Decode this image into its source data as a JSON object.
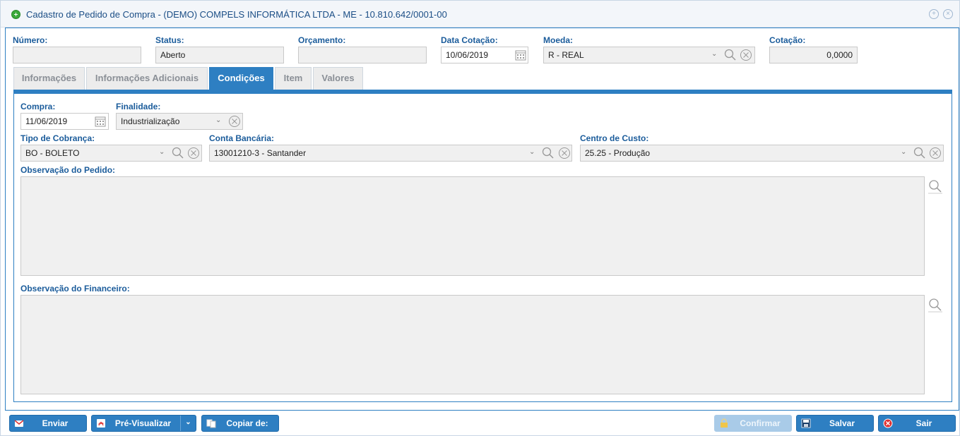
{
  "window": {
    "title": "Cadastro de Pedido de Compra - (DEMO) COMPELS INFORMÁTICA LTDA - ME - 10.810.642/0001-00"
  },
  "header": {
    "numero": {
      "label": "Número:",
      "value": ""
    },
    "status": {
      "label": "Status:",
      "value": "Aberto"
    },
    "orcamento": {
      "label": "Orçamento:",
      "value": ""
    },
    "data_cotacao": {
      "label": "Data Cotação:",
      "value": "10/06/2019"
    },
    "moeda": {
      "label": "Moeda:",
      "value": "R - REAL"
    },
    "cotacao": {
      "label": "Cotação:",
      "value": "0,0000"
    }
  },
  "tabs": [
    {
      "label": "Informações",
      "active": false
    },
    {
      "label": "Informações Adicionais",
      "active": false
    },
    {
      "label": "Condições",
      "active": true
    },
    {
      "label": "Item",
      "active": false
    },
    {
      "label": "Valores",
      "active": false
    }
  ],
  "conditions": {
    "compra": {
      "label": "Compra:",
      "value": "11/06/2019"
    },
    "finalidade": {
      "label": "Finalidade:",
      "value": "Industrialização"
    },
    "tipo_cobranca": {
      "label": "Tipo de Cobrança:",
      "value": "BO - BOLETO"
    },
    "conta_bancaria": {
      "label": "Conta Bancária:",
      "value": "13001210-3 - Santander"
    },
    "centro_custo": {
      "label": "Centro de Custo:",
      "value": "25.25 - Produção"
    },
    "obs_pedido": {
      "label": "Observação do Pedido:",
      "value": ""
    },
    "obs_financeiro": {
      "label": "Observação do Financeiro:",
      "value": ""
    }
  },
  "buttons": {
    "enviar": "Enviar",
    "pre_visualizar": "Pré-Visualizar",
    "copiar_de": "Copiar de:",
    "confirmar": "Confirmar",
    "salvar": "Salvar",
    "sair": "Sair"
  },
  "colors": {
    "accent": "#2e7fc2",
    "label": "#1b5c9b",
    "title": "#1b4e86"
  }
}
